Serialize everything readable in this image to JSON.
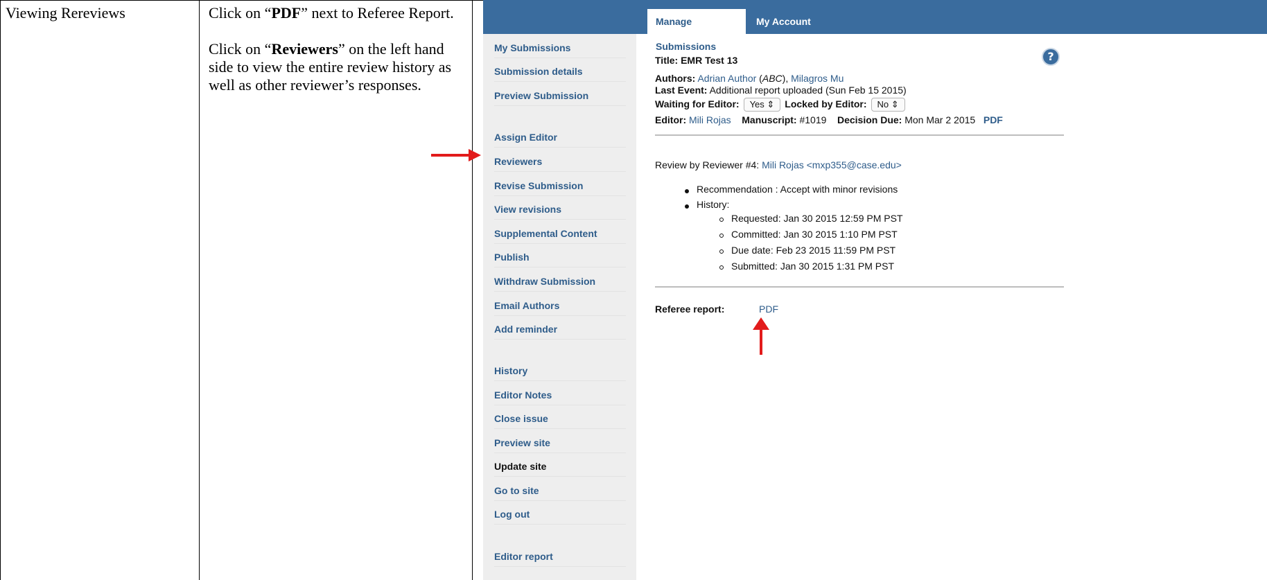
{
  "doc": {
    "col1_text": "Viewing Rereviews",
    "col2": {
      "line1_pre": "Click on “",
      "line1_bold": "PDF",
      "line1_post": "” next to Referee Report.",
      "line2_pre": "Click on “",
      "line2_bold": "Reviewers",
      "line2_post": "” on the left hand side to view the entire review history as well as other reviewer’s responses."
    }
  },
  "topbar": {
    "tabs": [
      "Manage Submissions",
      "My Account"
    ],
    "bg_color": "#3a6c9e"
  },
  "sidebar": {
    "items": [
      "My Submissions",
      "Submission details",
      "Preview Submission",
      "Assign Editor",
      "Reviewers",
      "Revise Submission",
      "View revisions",
      "Supplemental Content",
      "Publish",
      "Withdraw Submission",
      "Email Authors",
      "Add reminder",
      "History",
      "Editor Notes",
      "Close issue",
      "Preview site",
      "Update site",
      "Go to site",
      "Log out",
      "Editor report"
    ]
  },
  "submission": {
    "title_label": "Title:",
    "title_value": "EMR Test 13",
    "authors_label": "Authors:",
    "author1": "Adrian Author",
    "author1_aff_open": " (",
    "author1_aff": "ABC",
    "author1_aff_close": "), ",
    "author2": "Milagros Mu",
    "last_event_label": "Last Event:",
    "last_event_value": "Additional report uploaded (Sun Feb 15 2015)",
    "waiting_label": "Waiting for Editor:",
    "waiting_value": "Yes ⇕",
    "locked_label": "Locked by Editor:",
    "locked_value": "No ⇕",
    "editor_label": "Editor:",
    "editor_value": "Mili Rojas",
    "manuscript_label": "Manuscript:",
    "manuscript_value": "#1019",
    "decision_label": "Decision Due:",
    "decision_value": "Mon Mar 2 2015",
    "pdf_link": "PDF"
  },
  "review": {
    "heading_pre": "Review by Reviewer #4: ",
    "reviewer_link": "Mili Rojas <mxp355@case.edu>",
    "recommendation": "Recommendation : Accept with minor revisions",
    "history_label": "History:",
    "history": [
      "Requested: Jan 30 2015 12:59 PM PST",
      "Committed: Jan 30 2015 1:10 PM PST",
      "Due date: Feb 23 2015 11:59 PM PST",
      "Submitted: Jan 30 2015 1:31 PM PST"
    ],
    "referee_label": "Referee report:",
    "referee_pdf": "PDF"
  },
  "colors": {
    "link": "#2e5c8a",
    "arrow": "#e21b1b"
  }
}
